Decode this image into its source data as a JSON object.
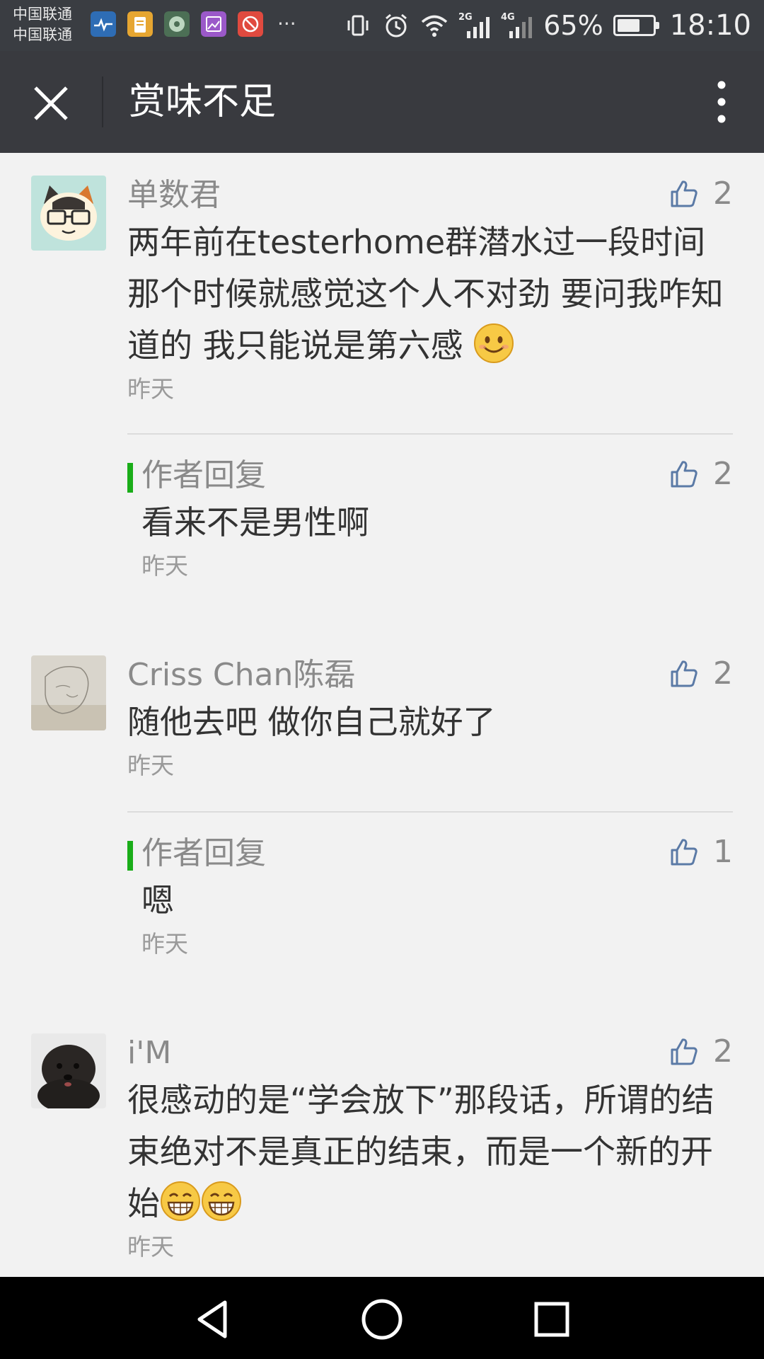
{
  "status_bar": {
    "carrier_1": "中国联通",
    "carrier_2": "中国联通",
    "battery_percent": "65%",
    "battery_level": 0.65,
    "time": "18:10",
    "signal_1": "2G",
    "signal_2": "4G",
    "more": "···"
  },
  "header": {
    "title": "赏味不足"
  },
  "comments": [
    {
      "nick": "单数君",
      "likes": "2",
      "content_text": "两年前在testerhome群潜水过一段时间 那个时候就感觉这个人不对劲 要问我咋知道的 我只能说是第六感",
      "time": "昨天",
      "reply": {
        "label": "作者回复",
        "likes": "2",
        "content": "看来不是男性啊",
        "time": "昨天"
      }
    },
    {
      "nick": "Criss Chan陈磊",
      "likes": "2",
      "content": "随他去吧 做你自己就好了",
      "time": "昨天",
      "reply": {
        "label": "作者回复",
        "likes": "1",
        "content": "嗯",
        "time": "昨天"
      }
    },
    {
      "nick": "i'M",
      "likes": "2",
      "content_text": "很感动的是“学会放下”那段话，所谓的结束绝对不是真正的结束，而是一个新的开始",
      "time": "昨天"
    }
  ]
}
